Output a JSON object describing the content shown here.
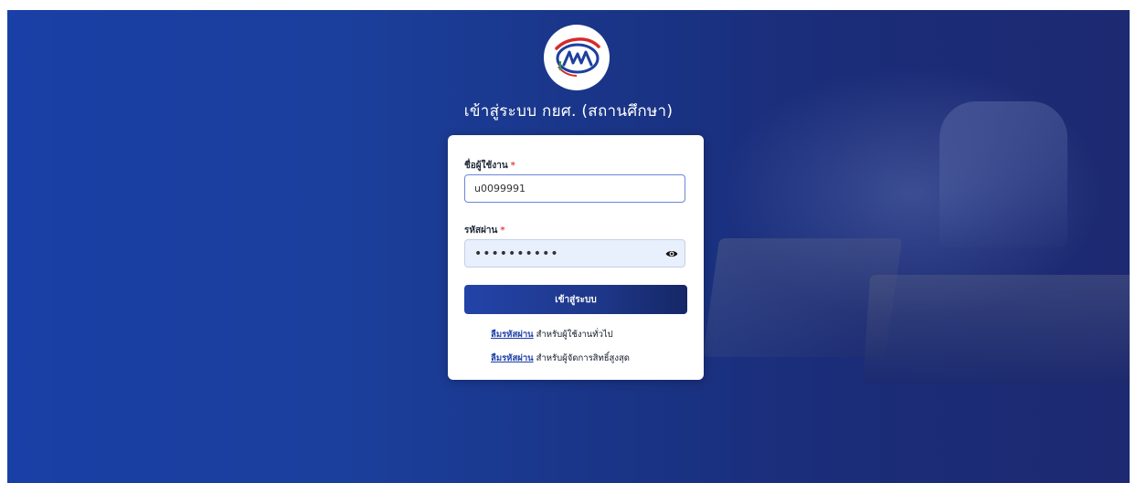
{
  "page": {
    "heading": "เข้าสู่ระบบ กยศ. (สถานศึกษา)"
  },
  "logo": {
    "icon": "gsl-fund-logo"
  },
  "form": {
    "username_label": "ชื่อผู้ใช้งาน",
    "username_value": "u0099991",
    "password_label": "รหัสผ่าน",
    "password_value": "••••••••••",
    "required_mark": "*",
    "submit_label": "เข้าสู่ระบบ",
    "show_password_icon": "eye-icon"
  },
  "links": [
    {
      "link_text": "ลืมรหัสผ่าน",
      "suffix": "สำหรับผู้ใช้งานทั่วไป"
    },
    {
      "link_text": "ลืมรหัสผ่าน",
      "suffix": "สำหรับผู้จัดการสิทธิ์สูงสุด"
    }
  ],
  "colors": {
    "background_start": "#1a3fa6",
    "background_end": "#1d2a72",
    "button": "#1e3789",
    "link": "#1d3fa8",
    "required": "#e5484d"
  }
}
